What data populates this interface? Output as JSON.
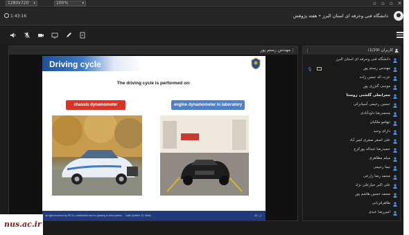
{
  "colors": {
    "accent_blue": "#4a90e2",
    "slide_header_blue": "#1d4f9a",
    "label_red": "#d8352a",
    "label_blue": "#4f7fc7",
    "footer_navy": "#223a7a",
    "watermark_red": "#7a1a1a"
  },
  "topbar": {
    "resolution": "1280x720",
    "zoom": "100%"
  },
  "header": {
    "title": "دانشگاه فنی وحرفه ای استان البرز • هفته پژوهش",
    "timer": "1:43:16"
  },
  "toolbar": {
    "icons": [
      "speaker-icon",
      "mic-off-icon",
      "camera-icon",
      "screen-icon",
      "pen-icon",
      "file-icon",
      "menu-icon"
    ]
  },
  "presenter": {
    "name": "مهندس رستم پور"
  },
  "slide": {
    "title": "Driving cycle",
    "subtitle": "The driving cycle is performed on:",
    "label_left": "chassis dynamometer",
    "label_right": "engine dynamometer in laboratory",
    "footer_left": "All right reserved by IPCO, confidential and no passing to third parties",
    "footer_mid": "Date (Caliber 12, Bold)",
    "footer_right": "52 / از"
  },
  "users_panel": {
    "header_label": "کاربران (1/29)"
  },
  "users": [
    {
      "name": "دانشگاه فنی وحرفه ای استان البرز",
      "bold": false,
      "mic": false,
      "screen": false
    },
    {
      "name": "مهندس رستم پور",
      "bold": false,
      "mic": true,
      "screen": true
    },
    {
      "name": "عزت اله حسن زاده",
      "bold": false,
      "mic": false,
      "screen": false
    },
    {
      "name": "موسی گنژری پور",
      "bold": false,
      "mic": false,
      "screen": false
    },
    {
      "name": "محرابعلی گلشنی روستا",
      "bold": true,
      "mic": false,
      "screen": false
    },
    {
      "name": "حسین رحیمی آسیابرکی",
      "bold": false,
      "mic": false,
      "screen": false
    },
    {
      "name": "محمدرضا داودآبادی",
      "bold": false,
      "mic": false,
      "screen": false
    },
    {
      "name": "تیهامو ملکیان",
      "bold": false,
      "mic": false,
      "screen": false
    },
    {
      "name": "دارای وحید",
      "bold": false,
      "mic": false,
      "screen": false
    },
    {
      "name": "علی اصغر صفری امیر آباد",
      "bold": false,
      "mic": false,
      "screen": false
    },
    {
      "name": "حمیدرضا عبداله پورکرخ",
      "bold": false,
      "mic": false,
      "screen": false
    },
    {
      "name": "میلم مظاهری",
      "bold": false,
      "mic": false,
      "screen": false
    },
    {
      "name": "نیما رحیمی",
      "bold": false,
      "mic": false,
      "screen": false
    },
    {
      "name": "محمد رضا زارعی",
      "bold": false,
      "mic": false,
      "screen": false
    },
    {
      "name": "علی اکبر خیازعلی نژاد",
      "bold": false,
      "mic": false,
      "screen": false
    },
    {
      "name": "محمد حسین هاشم پور",
      "bold": false,
      "mic": false,
      "screen": false
    },
    {
      "name": "طاهرقربانی",
      "bold": false,
      "mic": false,
      "screen": false
    },
    {
      "name": "امیررضا عبدی",
      "bold": false,
      "mic": false,
      "screen": false
    }
  ],
  "watermark": {
    "text": "nus.ac.ir"
  }
}
